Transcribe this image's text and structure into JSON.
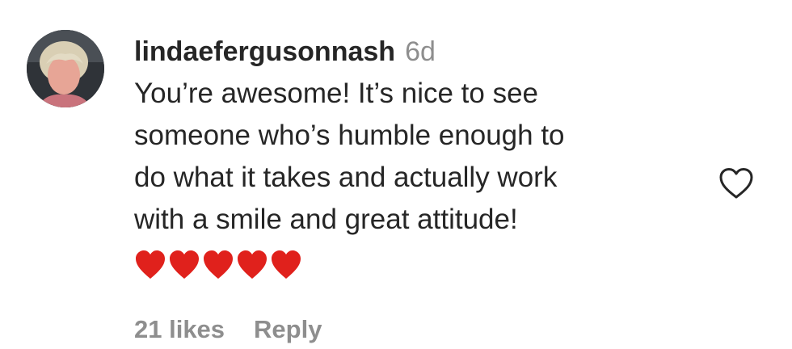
{
  "comment": {
    "username": "lindaefergusonnash",
    "time_ago": "6d",
    "text_lines": [
      "You’re awesome! It’s nice to see",
      "someone who’s humble enough to",
      "do what it takes and actually work",
      "with a smile and great attitude!"
    ],
    "emoji": [
      "red-heart",
      "red-heart",
      "red-heart",
      "red-heart",
      "red-heart"
    ],
    "likes_label": "21 likes",
    "reply_label": "Reply"
  },
  "icons": {
    "like": "heart-outline-icon",
    "emoji": "red-heart-emoji"
  },
  "colors": {
    "text": "#262626",
    "muted": "#8e8e8e",
    "heart_emoji": "#e0211c",
    "like_icon": "#262626"
  }
}
